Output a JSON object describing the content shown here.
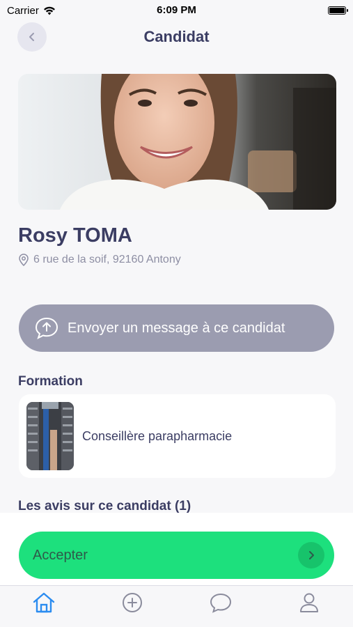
{
  "status_bar": {
    "carrier": "Carrier",
    "time": "6:09 PM"
  },
  "header": {
    "title": "Candidat",
    "back_icon": "chevron-left-icon"
  },
  "candidate": {
    "name": "Rosy TOMA",
    "address": "6 rue de la soif, 92160 Antony",
    "address_icon": "location-pin-icon",
    "photo": "candidate-portrait"
  },
  "actions": {
    "message_label": "Envoyer un message à ce candidat",
    "message_icon": "chat-upload-icon",
    "accept_label": "Accepter",
    "accept_icon": "chevron-right-icon"
  },
  "formation": {
    "section_title": "Formation",
    "items": [
      {
        "label": "Conseillère parapharmacie",
        "image": "pharmacy-shelves"
      }
    ]
  },
  "reviews": {
    "section_title": "Les avis sur ce candidat (1)"
  },
  "tab_bar": {
    "tabs": [
      {
        "name": "home",
        "icon": "home-icon",
        "active": true
      },
      {
        "name": "add",
        "icon": "plus-circle-icon",
        "active": false
      },
      {
        "name": "messages",
        "icon": "chat-bubble-icon",
        "active": false
      },
      {
        "name": "profile",
        "icon": "user-icon",
        "active": false
      }
    ]
  },
  "colors": {
    "title": "#3b3d63",
    "message_button": "#9b9cb0",
    "accept_button": "#1de07d",
    "active_tab": "#2b8cf0",
    "inactive_tab": "#8a8b9c"
  }
}
